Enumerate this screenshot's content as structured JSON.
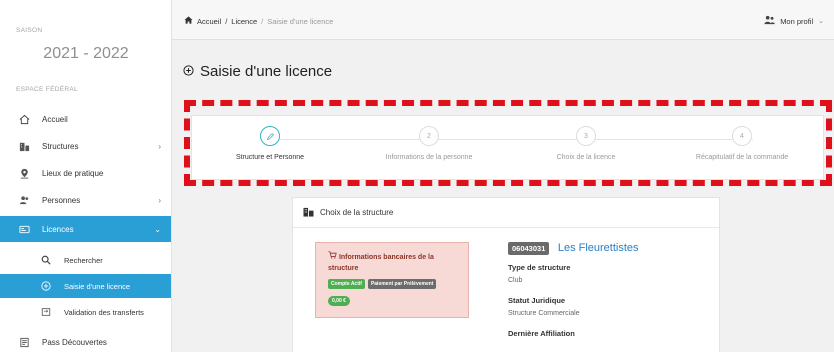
{
  "sidebar": {
    "season_label": "SAISON",
    "season": "2021 - 2022",
    "section_label": "ESPACE FÉDÉRAL",
    "items": [
      {
        "label": "Accueil",
        "icon": "home-icon"
      },
      {
        "label": "Structures",
        "icon": "building-icon"
      },
      {
        "label": "Lieux de pratique",
        "icon": "location-pin-icon"
      },
      {
        "label": "Personnes",
        "icon": "users-icon"
      },
      {
        "label": "Licences",
        "icon": "card-icon"
      },
      {
        "label": "Pass Découvertes",
        "icon": "ticket-icon"
      }
    ],
    "sub_items": [
      {
        "label": "Rechercher",
        "icon": "search-icon"
      },
      {
        "label": "Saisie d'une licence",
        "icon": "plus-circle-icon"
      },
      {
        "label": "Validation des transferts",
        "icon": "transfer-icon"
      }
    ]
  },
  "breadcrumb": {
    "home": "Accueil",
    "sep": "/",
    "level1": "Licence",
    "level2": "Saisie d'une licence"
  },
  "profile": {
    "label": "Mon profil"
  },
  "page": {
    "title": "Saisie d'une licence"
  },
  "steps": [
    {
      "number": "",
      "label": "Structure et Personne"
    },
    {
      "number": "2",
      "label": "Informations de la personne"
    },
    {
      "number": "3",
      "label": "Choix de la licence"
    },
    {
      "number": "4",
      "label": "Récapitulatif de la commande"
    }
  ],
  "card": {
    "title": "Choix de la structure",
    "bank": {
      "title": "Informations bancaires de la structure",
      "badge1": "Compte Actif",
      "badge2": "Paiement par Prélèvement",
      "amount": "0,00 €"
    },
    "structure": {
      "code": "06043031",
      "name": "Les Fleurettistes",
      "type_label": "Type de structure",
      "type_value": "Club",
      "status_label": "Statut Juridique",
      "status_value": "Structure Commerciale",
      "affiliation_label": "Dernière Affiliation"
    }
  },
  "colors": {
    "accent": "#2a9fd6",
    "step_active": "#2fb5c8",
    "highlight": "#e0101a"
  }
}
